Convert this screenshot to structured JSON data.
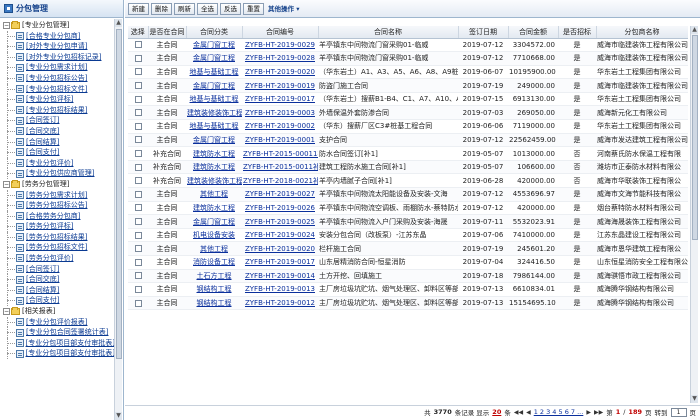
{
  "sidebar": {
    "title": "分包管理",
    "tree": [
      {
        "kind": "group",
        "label": "[专业分包管理]",
        "expanded": true
      },
      {
        "kind": "leaf",
        "label": "[合格专业分包商]"
      },
      {
        "kind": "leaf",
        "label": "[对外专业分包申请]"
      },
      {
        "kind": "leaf",
        "label": "[对外专业分包招标记录]"
      },
      {
        "kind": "leaf",
        "label": "[专业分包需求计划]"
      },
      {
        "kind": "leaf",
        "label": "[专业分包招标公告]"
      },
      {
        "kind": "leaf",
        "label": "[专业分包招标文件]"
      },
      {
        "kind": "leaf",
        "label": "[专业分包评标]"
      },
      {
        "kind": "leaf",
        "label": "[专业分包招标结果]"
      },
      {
        "kind": "leaf",
        "label": "[合同签订]"
      },
      {
        "kind": "leaf",
        "label": "[合同交底]"
      },
      {
        "kind": "leaf",
        "label": "[合同结算]"
      },
      {
        "kind": "leaf",
        "label": "[合同支付]"
      },
      {
        "kind": "leaf",
        "label": "[专业分包评价]"
      },
      {
        "kind": "leaf",
        "label": "[专业分包供应商管理]"
      },
      {
        "kind": "group",
        "label": "[劳务分包管理]",
        "expanded": true
      },
      {
        "kind": "leaf",
        "label": "[劳务分包需求计划]"
      },
      {
        "kind": "leaf",
        "label": "[劳务分包招标公告]"
      },
      {
        "kind": "leaf",
        "label": "[合格劳务分包商]"
      },
      {
        "kind": "leaf",
        "label": "[劳务分包评标]"
      },
      {
        "kind": "leaf",
        "label": "[劳务分包招标结果]"
      },
      {
        "kind": "leaf",
        "label": "[劳务分包招标文件]"
      },
      {
        "kind": "leaf",
        "label": "[劳务分包评价]"
      },
      {
        "kind": "leaf",
        "label": "[合同签订]"
      },
      {
        "kind": "leaf",
        "label": "[合同交底]"
      },
      {
        "kind": "leaf",
        "label": "[合同结算]"
      },
      {
        "kind": "leaf",
        "label": "[合同支付]"
      },
      {
        "kind": "group",
        "label": "[相关报表]",
        "expanded": true
      },
      {
        "kind": "leaf",
        "label": "[专业分包评价报表]"
      },
      {
        "kind": "leaf",
        "label": "[专业分包合同签署统计表]"
      },
      {
        "kind": "leaf",
        "label": "[专业分包项目部支付审批表]"
      },
      {
        "kind": "leaf",
        "label": "[专业分包项目部支付审批表]"
      }
    ]
  },
  "toolbar": {
    "buttons": [
      "新建",
      "删除",
      "刷新",
      "全选",
      "反选",
      "重置"
    ],
    "more_ops": "其他操作"
  },
  "grid": {
    "columns": [
      "选择",
      "是否在合同",
      "合同分类",
      "合同编号",
      "合同名称",
      "签订日期",
      "合同金额",
      "是否招标",
      "分包商名称"
    ],
    "rows": [
      [
        "主合同",
        "金属门窗工程",
        "ZYFB-HT-2019-0029",
        "羊亭镇东中间物流门窗采购01-临威",
        "2019-07-12",
        "3304572.00",
        "是",
        "威海市临建装饰工程有限公司"
      ],
      [
        "主合同",
        "金属门窗工程",
        "ZYFB-HT-2019-0028",
        "羊亭镇东中间物流门窗采购01-临威",
        "2019-07-12",
        "7710668.00",
        "是",
        "威海市临建装饰工程有限公司"
      ],
      [
        "主合同",
        "地基与基础工程",
        "ZYFB-HT-2019-0020",
        "（华东岩土）A1、A3、A5、A6、A8、A9桩",
        "2019-06-07",
        "10195900.00",
        "是",
        "华东岩土工程集团有限公司"
      ],
      [
        "主合同",
        "金属门窗工程",
        "ZYFB-HT-2019-0019",
        "防盗门施工合同",
        "2019-07-19",
        "249000.00",
        "是",
        "威海市临建装饰工程有限公司"
      ],
      [
        "主合同",
        "地基与基础工程",
        "ZYFB-HT-2019-0017",
        "（华东岩土）搜薪B1-B4、C1、A7、A10、A",
        "2019-07-15",
        "6913130.00",
        "是",
        "华东岩土工程集团有限公司"
      ],
      [
        "主合同",
        "建筑装修装饰工程",
        "ZYFB-HT-2019-0003",
        "外墙保温外套防渗合同",
        "2019-07-03",
        "269050.00",
        "是",
        "威海新元化工有限公司"
      ],
      [
        "主合同",
        "地基与基础工程",
        "ZYFB-HT-2019-0002",
        "（华东）搜薪厂区C3#桩基工程合同",
        "2019-06-06",
        "7119000.00",
        "是",
        "华东岩土工程集团有限公司"
      ],
      [
        "主合同",
        "金属门窗工程",
        "ZYFB-HT-2019-0001",
        "支护合同",
        "2019-07-12",
        "22562459.00",
        "是",
        "威海市发达建筑工程有限公司"
      ],
      [
        "补充合同",
        "建筑防水工程",
        "ZYFB-HT-2015-00011补1",
        "防水合同签订[补1]",
        "2019-05-07",
        "1013000.00",
        "否",
        "河南蔡氏防水保温工程有限"
      ],
      [
        "补充合同",
        "建筑防水工程",
        "ZYFB-HT-2015-0011补1",
        "建筑工程防水施工合同[补1]",
        "2019-05-07",
        "106600.00",
        "否",
        "潍坊市正泰防水材料有限公"
      ],
      [
        "补充合同",
        "建筑装修装饰工程",
        "ZYFB-HT-2018-0021补1",
        "羊亭内墙腻子合同[补1]",
        "2019-06-28",
        "420000.00",
        "否",
        "威海市华联装饰工程有限公"
      ],
      [
        "主合同",
        "其他工程",
        "ZYFB-HT-2019-0027",
        "羊亭镇东中间物流太阳能设备及安装-文海",
        "2019-07-12",
        "4553696.97",
        "是",
        "威海市文海节能科技有限公"
      ],
      [
        "主合同",
        "建筑防水工程",
        "ZYFB-HT-2019-0026",
        "羊亭镇东中间物流空调板、雨棚防水-蔡特防水",
        "2019-07-12",
        "420000.00",
        "是",
        "烟台蔡特防水材料有限公司"
      ],
      [
        "主合同",
        "金属门窗工程",
        "ZYFB-HT-2019-0025",
        "羊亭镇东中间物流入户门采购及安装-海晟",
        "2019-07-11",
        "5532023.91",
        "是",
        "威海海晟装饰工程有限公司"
      ],
      [
        "主合同",
        "机电设备安装",
        "ZYFB-HT-2019-0024",
        "安装分包合同（改板泵）-江苏东晶",
        "2019-07-06",
        "7410000.00",
        "是",
        "江苏东晶建设工程有限公司"
      ],
      [
        "主合同",
        "其他工程",
        "ZYFB-HT-2019-0020",
        "栏杆施工合同",
        "2019-07-19",
        "245601.20",
        "是",
        "威海市恩华建筑工程有限公"
      ],
      [
        "主合同",
        "消防设备工程",
        "ZYFB-HT-2019-0017",
        "山东居精消防合同-恒星消防",
        "2019-07-04",
        "324416.50",
        "是",
        "山东恒星消防安全工程有限公"
      ],
      [
        "主合同",
        "土石方工程",
        "ZYFB-HT-2019-0014",
        "土方开挖、回填施工",
        "2019-07-18",
        "7986144.00",
        "是",
        "威海骐悟市政工程有限公司"
      ],
      [
        "主合同",
        "钢结构工程",
        "ZYFB-HT-2019-0013",
        "主厂房垃圾坑贮坑、烟气处理区、卸料区等部",
        "2019-07-13",
        "6610834.01",
        "是",
        "威海腾华钢结构有限公司"
      ],
      [
        "主合同",
        "钢结构工程",
        "ZYFB-HT-2019-0012",
        "主厂房垃圾坑贮坑、烟气处理区、卸料区等部",
        "2019-07-13",
        "15154695.10",
        "是",
        "威海腾华钢结构有限公司"
      ]
    ]
  },
  "pager": {
    "total_prefix": "共",
    "total": "3770",
    "total_suffix": "条记录 显示",
    "page_size": "20",
    "per_page": "条",
    "pages_text": "1 2 3 4 5 6 7 ...",
    "page_label": "第",
    "current": "1",
    "sep": "/",
    "page_count": "189",
    "page_suffix": "页",
    "goto_label": "转到",
    "goto_value": "1",
    "goto_suffix": "页"
  }
}
